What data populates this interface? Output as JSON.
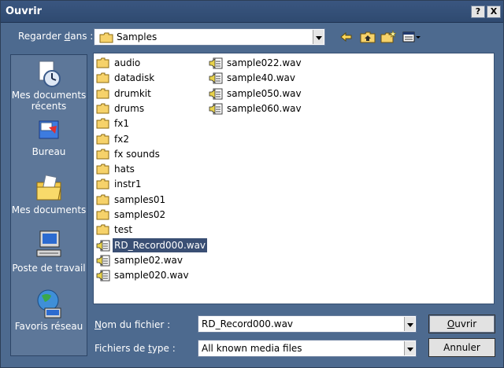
{
  "window": {
    "title": "Ouvrir"
  },
  "titlebar": {
    "help_label": "?",
    "close_label": "X"
  },
  "lookin": {
    "label_pre": "Regarder ",
    "label_key": "d",
    "label_post": "ans :",
    "value": "Samples"
  },
  "toolbar": {
    "back_icon": "back-arrow-icon",
    "up_icon": "up-folder-icon",
    "new_folder_icon": "new-folder-icon",
    "view_icon": "view-menu-icon"
  },
  "places": [
    {
      "label": "Mes documents récents",
      "icon": "recent-documents-icon"
    },
    {
      "label": "Bureau",
      "icon": "desktop-icon"
    },
    {
      "label": "Mes documents",
      "icon": "my-documents-icon"
    },
    {
      "label": "Poste de travail",
      "icon": "my-computer-icon"
    },
    {
      "label": "Favoris réseau",
      "icon": "network-places-icon"
    }
  ],
  "files_col1": [
    {
      "name": "audio",
      "type": "folder"
    },
    {
      "name": "datadisk",
      "type": "folder"
    },
    {
      "name": "drumkit",
      "type": "folder"
    },
    {
      "name": "drums",
      "type": "folder"
    },
    {
      "name": "fx1",
      "type": "folder"
    },
    {
      "name": "fx2",
      "type": "folder"
    },
    {
      "name": "fx sounds",
      "type": "folder"
    },
    {
      "name": "hats",
      "type": "folder"
    },
    {
      "name": "instr1",
      "type": "folder"
    },
    {
      "name": "samples01",
      "type": "folder"
    },
    {
      "name": "samples02",
      "type": "folder"
    },
    {
      "name": "test",
      "type": "folder"
    },
    {
      "name": "RD_Record000.wav",
      "type": "wav",
      "selected": true
    },
    {
      "name": "sample02.wav",
      "type": "wav"
    },
    {
      "name": "sample020.wav",
      "type": "wav"
    }
  ],
  "files_col2": [
    {
      "name": "sample022.wav",
      "type": "wav"
    },
    {
      "name": "sample40.wav",
      "type": "wav"
    },
    {
      "name": "sample050.wav",
      "type": "wav"
    },
    {
      "name": "sample060.wav",
      "type": "wav"
    }
  ],
  "filename": {
    "label_pre": "",
    "label_key": "N",
    "label_post": "om du fichier :",
    "value": "RD_Record000.wav"
  },
  "filetype": {
    "label_pre": "Fichiers de ",
    "label_key": "t",
    "label_post": "ype :",
    "value": "All known media files"
  },
  "buttons": {
    "open_key": "O",
    "open_rest": "uvrir",
    "cancel": "Annuler"
  }
}
